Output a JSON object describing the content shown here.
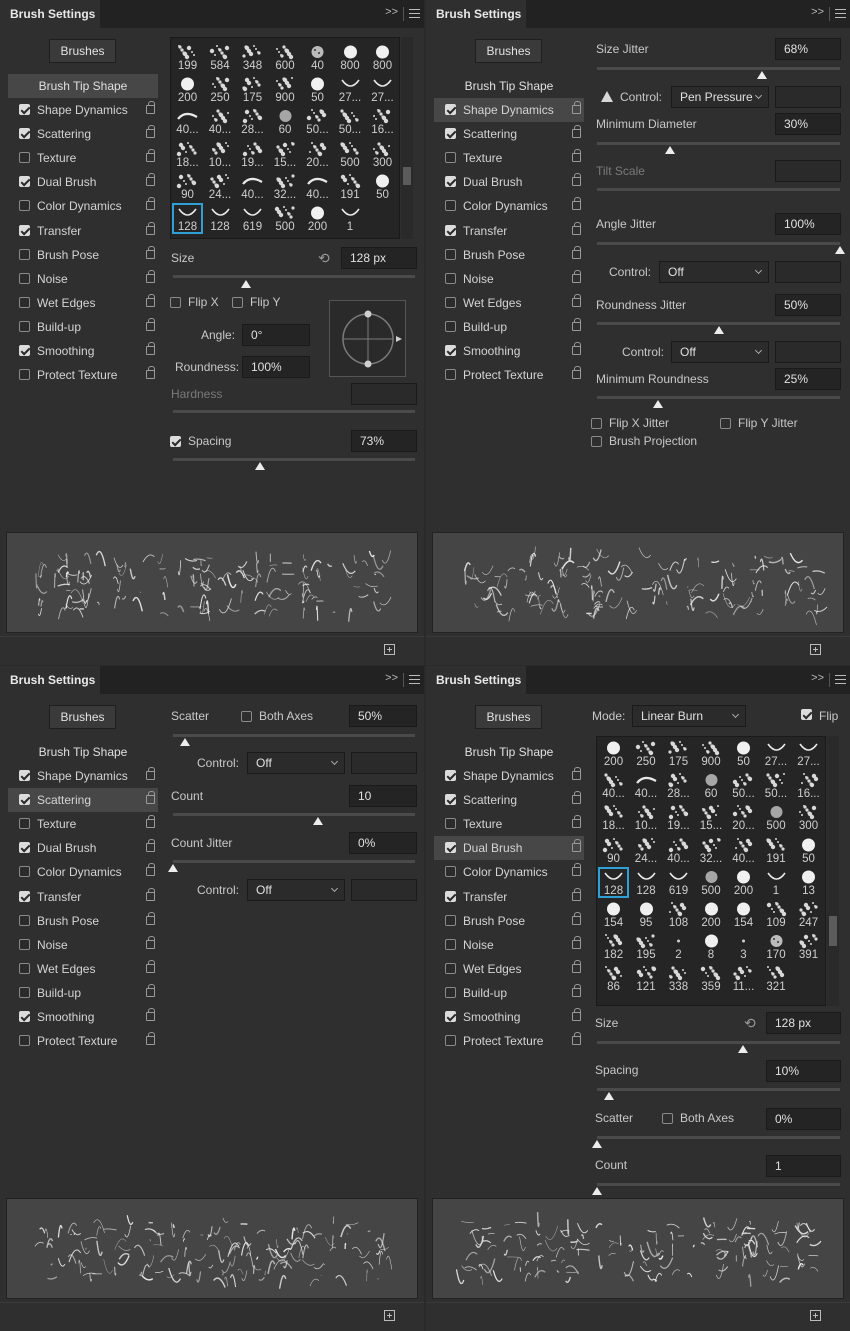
{
  "panel_title": "Brush Settings",
  "brushes_button": "Brushes",
  "icon_names": {
    "expand": "double-chevron-icon",
    "menu": "hamburger-menu-icon",
    "lock": "lock-icon",
    "reset": "reset-icon",
    "new": "new-brush-icon",
    "warning": "warning-icon"
  },
  "accent_color": "#2fa0d6",
  "menu": [
    {
      "label": "Brush Tip Shape",
      "checkbox": false,
      "checked": false,
      "lock": false
    },
    {
      "label": "Shape Dynamics",
      "checkbox": true,
      "checked": true,
      "lock": true
    },
    {
      "label": "Scattering",
      "checkbox": true,
      "checked": true,
      "lock": true
    },
    {
      "label": "Texture",
      "checkbox": true,
      "checked": false,
      "lock": true
    },
    {
      "label": "Dual Brush",
      "checkbox": true,
      "checked": true,
      "lock": true
    },
    {
      "label": "Color Dynamics",
      "checkbox": true,
      "checked": false,
      "lock": true
    },
    {
      "label": "Transfer",
      "checkbox": true,
      "checked": true,
      "lock": true
    },
    {
      "label": "Brush Pose",
      "checkbox": true,
      "checked": false,
      "lock": true
    },
    {
      "label": "Noise",
      "checkbox": true,
      "checked": false,
      "lock": true
    },
    {
      "label": "Wet Edges",
      "checkbox": true,
      "checked": false,
      "lock": true
    },
    {
      "label": "Build-up",
      "checkbox": true,
      "checked": false,
      "lock": true
    },
    {
      "label": "Smoothing",
      "checkbox": true,
      "checked": true,
      "lock": true
    },
    {
      "label": "Protect Texture",
      "checkbox": true,
      "checked": false,
      "lock": true
    }
  ],
  "panels": [
    {
      "selected_item": 0,
      "tip_grid": {
        "cells": [
          "199",
          "584",
          "348",
          "600",
          "40",
          "800",
          "800",
          "200",
          "250",
          "175",
          "900",
          "50",
          "27...",
          "27...",
          "40...",
          "40...",
          "28...",
          "60",
          "50...",
          "50...",
          "16...",
          "18...",
          "10...",
          "19...",
          "15...",
          "20...",
          "500",
          "300",
          "90",
          "24...",
          "40...",
          "32...",
          "40...",
          "191",
          "50",
          "128",
          "128",
          "619",
          "500",
          "200",
          "1"
        ],
        "selected": 35,
        "scroll": 0.3
      },
      "size": {
        "label": "Size",
        "value": "128 px",
        "fraction": 0.3
      },
      "flip_x": {
        "label": "Flip X",
        "checked": false
      },
      "flip_y": {
        "label": "Flip Y",
        "checked": false
      },
      "angle": {
        "label": "Angle:",
        "value": "0°"
      },
      "roundness": {
        "label": "Roundness:",
        "value": "100%"
      },
      "hardness": {
        "label": "Hardness",
        "value": ""
      },
      "spacing": {
        "label": "Spacing",
        "checked": true,
        "value": "73%",
        "fraction": 0.36
      }
    },
    {
      "selected_item": 1,
      "size_jitter": {
        "label": "Size Jitter",
        "value": "68%",
        "fraction": 0.68
      },
      "control1": {
        "label": "Control:",
        "value": "Pen Pressure"
      },
      "min_diameter": {
        "label": "Minimum Diameter",
        "value": "30%",
        "fraction": 0.3
      },
      "tilt_scale": {
        "label": "Tilt Scale",
        "value": ""
      },
      "angle_jitter": {
        "label": "Angle Jitter",
        "value": "100%",
        "fraction": 1.0
      },
      "control2": {
        "label": "Control:",
        "value": "Off"
      },
      "roundness_jitter": {
        "label": "Roundness Jitter",
        "value": "50%",
        "fraction": 0.5
      },
      "control3": {
        "label": "Control:",
        "value": "Off"
      },
      "min_roundness": {
        "label": "Minimum Roundness",
        "value": "25%",
        "fraction": 0.25
      },
      "flip_x_jitter": {
        "label": "Flip X Jitter",
        "checked": false
      },
      "flip_y_jitter": {
        "label": "Flip Y Jitter",
        "checked": false
      },
      "brush_projection": {
        "label": "Brush Projection",
        "checked": false
      }
    },
    {
      "selected_item": 2,
      "scatter": {
        "label": "Scatter",
        "value": "50%",
        "fraction": 0.05
      },
      "both_axes": {
        "label": "Both Axes",
        "checked": false
      },
      "control1": {
        "label": "Control:",
        "value": "Off"
      },
      "count": {
        "label": "Count",
        "value": "10",
        "fraction": 0.6
      },
      "count_jitter": {
        "label": "Count Jitter",
        "value": "0%",
        "fraction": 0.0
      },
      "control2": {
        "label": "Control:",
        "value": "Off"
      }
    },
    {
      "selected_item": 4,
      "mode": {
        "label": "Mode:",
        "value": "Linear Burn"
      },
      "flip": {
        "label": "Flip",
        "checked": true
      },
      "tip_grid": {
        "cells": [
          "200",
          "250",
          "175",
          "900",
          "50",
          "27...",
          "27...",
          "40...",
          "40...",
          "28...",
          "60",
          "50...",
          "50...",
          "16...",
          "18...",
          "10...",
          "19...",
          "15...",
          "20...",
          "500",
          "300",
          "90",
          "24...",
          "40...",
          "32...",
          "40...",
          "191",
          "50",
          "128",
          "128",
          "619",
          "500",
          "200",
          "1",
          "13",
          "154",
          "95",
          "108",
          "200",
          "154",
          "109",
          "247",
          "182",
          "195",
          "2",
          "8",
          "3",
          "170",
          "391",
          "86",
          "121",
          "338",
          "359",
          "11...",
          "321"
        ],
        "selected": 28,
        "scroll": 0.65
      },
      "size": {
        "label": "Size",
        "value": "128 px",
        "fraction": 0.6
      },
      "spacing": {
        "label": "Spacing",
        "value": "10%",
        "fraction": 0.05
      },
      "scatter": {
        "label": "Scatter",
        "value": "0%",
        "fraction": 0.0
      },
      "both_axes": {
        "label": "Both Axes",
        "checked": false
      },
      "count": {
        "label": "Count",
        "value": "1",
        "fraction": 0.0
      }
    }
  ]
}
